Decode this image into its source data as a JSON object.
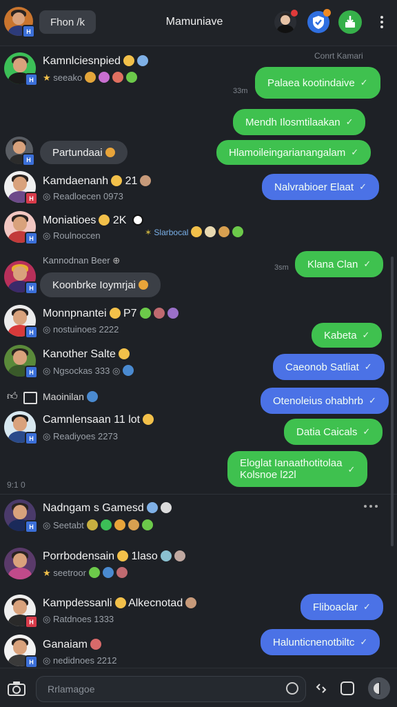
{
  "header": {
    "back_chip": "Fhon /k",
    "title": "Mamuniave",
    "menu_icon": "more-vertical-icon"
  },
  "top_right_note": "Conrt Kamari",
  "rows": [
    {
      "name": "Kamnlciesnpied",
      "sub": "seeako"
    },
    {
      "name": "Kamdaenanh",
      "sub": "Readloecen 0973"
    },
    {
      "name": "Moniatioes",
      "sub": "Roulnoccen"
    },
    {
      "name": "Kannodnan Beer"
    },
    {
      "name": "Monnpnantei",
      "sub": "nostuinoes 2222"
    },
    {
      "name": "Kanother Salte",
      "sub": "Ngsockas 333"
    },
    {
      "name": "Maoinilan"
    },
    {
      "name": "Camnlensaan 11 lot",
      "sub": "Readiyoes 2273"
    },
    {
      "name": "Nadngam s Gamesd",
      "sub": "Seetabt"
    },
    {
      "name": "Porrbodensain",
      "name_suffix": "1laso",
      "sub": "seetroor"
    },
    {
      "name": "Kampdessanli",
      "name_suffix": "Alkecnotad",
      "sub": "Ratdnoes 1333"
    },
    {
      "name": "Ganaiam",
      "sub": "nedidnoes 2212"
    }
  ],
  "extra_labels": {
    "row2_suffix": "21",
    "row3_suffix": "2K",
    "row5_suffix": "P7",
    "row3_side_label": "Slarbocal",
    "divider_label": "9:1 0",
    "time_a": "33m",
    "time_b": "3sm"
  },
  "gray_bubbles": [
    {
      "text": "Partundaai"
    },
    {
      "text": "Koonbrke Ioymrjai"
    }
  ],
  "bubbles": [
    {
      "text": "Palaea kootindaive",
      "color": "green"
    },
    {
      "text": "Mendh Ilosmtilaakan",
      "color": "green"
    },
    {
      "text": "Hlamoileingarianangalam",
      "color": "green"
    },
    {
      "text": "Nalvrabioer Elaat",
      "color": "blue"
    },
    {
      "text": "Klana Clan",
      "color": "green"
    },
    {
      "text": "Kabeta",
      "color": "green"
    },
    {
      "text": "Caeonob Satliat",
      "color": "blue"
    },
    {
      "text": "Otenoleius ohabhrb",
      "color": "blue"
    },
    {
      "text": "Datia Caicals",
      "color": "green"
    },
    {
      "text": "Eloglat Ianaathotitolaa",
      "text2": "Kolsnoe l22l",
      "color": "green"
    },
    {
      "text": "Fliboaclar",
      "color": "blue"
    },
    {
      "text": "Halunticnenotbiltc",
      "color": "blue"
    }
  ],
  "composer": {
    "placeholder": "Rrlamagoe"
  },
  "colors": {
    "green_bubble": "#3fc14f",
    "blue_bubble": "#4b72e6",
    "background": "#1e2126"
  }
}
